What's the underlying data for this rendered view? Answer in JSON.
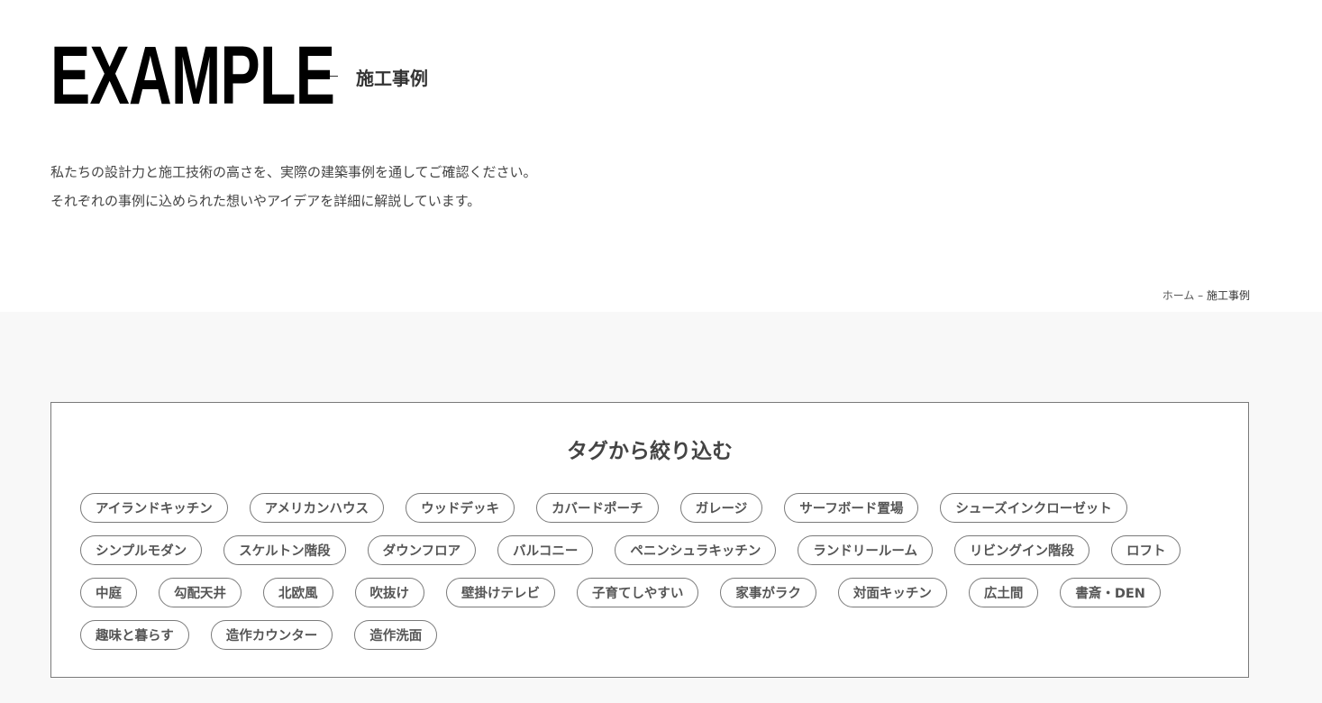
{
  "header": {
    "title_en": "EXAMPLE",
    "title_jp": "施工事例"
  },
  "intro": {
    "line1": "私たちの設計力と施工技術の高さを、実際の建築事例を通してご確認ください。",
    "line2": "それぞれの事例に込められた想いやアイデアを詳細に解説しています。"
  },
  "breadcrumb": {
    "home": "ホーム",
    "separator": "–",
    "current": "施工事例"
  },
  "filter": {
    "title": "タグから絞り込む",
    "tags": [
      "アイランドキッチン",
      "アメリカンハウス",
      "ウッドデッキ",
      "カバードポーチ",
      "ガレージ",
      "サーフボード置場",
      "シューズインクローゼット",
      "シンプルモダン",
      "スケルトン階段",
      "ダウンフロア",
      "バルコニー",
      "ペニンシュラキッチン",
      "ランドリールーム",
      "リビングイン階段",
      "ロフト",
      "中庭",
      "勾配天井",
      "北欧風",
      "吹抜け",
      "壁掛けテレビ",
      "子育てしやすい",
      "家事がラク",
      "対面キッチン",
      "広土間",
      "書斎・DEN",
      "趣味と暮らす",
      "造作カウンター",
      "造作洗面"
    ]
  },
  "colors": {
    "background_top": "#ffffff",
    "background_bottom": "#f8f8f8",
    "border": "#7a7a7a",
    "text": "#333333"
  }
}
